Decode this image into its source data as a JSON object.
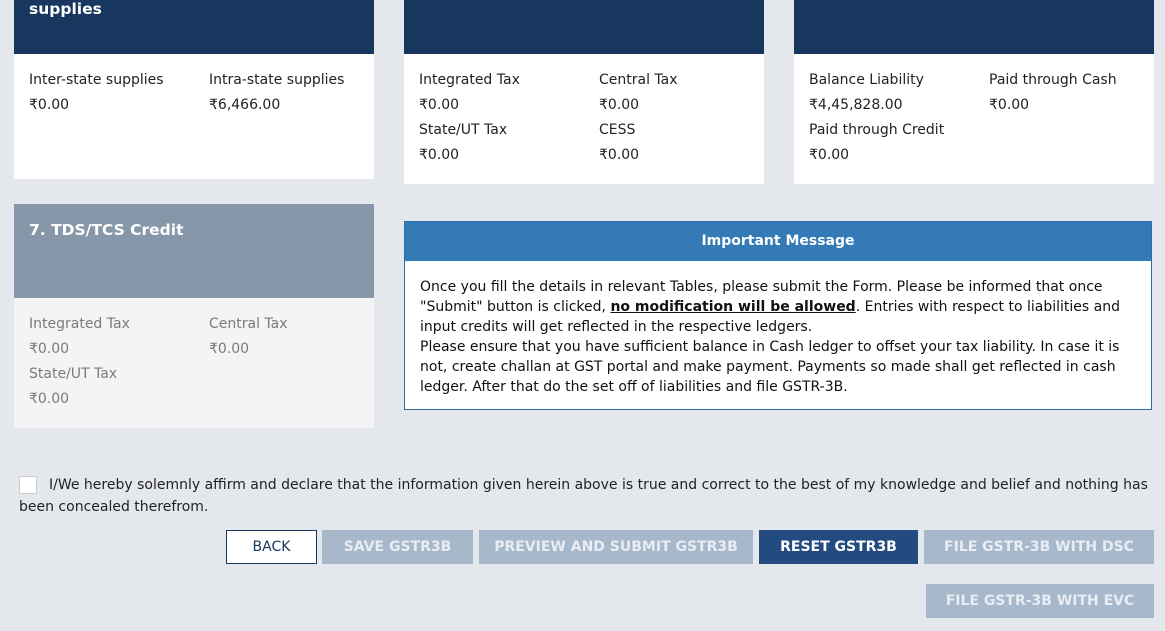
{
  "card1": {
    "title": "supplies",
    "fields": [
      {
        "label": "Inter-state supplies",
        "value": "₹0.00"
      },
      {
        "label": "Intra-state supplies",
        "value": "₹6,466.00"
      }
    ]
  },
  "card2": {
    "fields": [
      {
        "label": "Integrated Tax",
        "value": "₹0.00"
      },
      {
        "label": "Central Tax",
        "value": "₹0.00"
      },
      {
        "label": "State/UT Tax",
        "value": "₹0.00"
      },
      {
        "label": "CESS",
        "value": "₹0.00"
      }
    ]
  },
  "card3": {
    "fields": [
      {
        "label": "Balance Liability",
        "value": "₹4,45,828.00"
      },
      {
        "label": "Paid through Cash",
        "value": "₹0.00"
      },
      {
        "label": "Paid through Credit",
        "value": "₹0.00"
      }
    ]
  },
  "card4": {
    "title": "7. TDS/TCS Credit",
    "fields": [
      {
        "label": "Integrated Tax",
        "value": "₹0.00"
      },
      {
        "label": "Central Tax",
        "value": "₹0.00"
      },
      {
        "label": "State/UT Tax",
        "value": "₹0.00"
      }
    ]
  },
  "message": {
    "title": "Important Message",
    "p1_before": "Once you fill the details in relevant Tables, please submit the Form. Please be informed that once \"Submit\" button is clicked, ",
    "p1_bold": "no modification will be allowed",
    "p1_after": ". Entries with respect to liabilities and input credits will get reflected in the respective ledgers.",
    "p2": "Please ensure that you have sufficient balance in Cash ledger to offset your tax liability. In case it is not, create challan at GST portal and make payment. Payments so made shall get reflected in cash ledger. After that do the set off of liabilities and file GSTR-3B."
  },
  "declaration": {
    "checked": false,
    "text": "I/We hereby solemnly affirm and declare that the information given herein above is true and correct to the best of my knowledge and belief and nothing has been concealed therefrom."
  },
  "buttons": {
    "back": "BACK",
    "save": "SAVE GSTR3B",
    "preview": "PREVIEW AND SUBMIT GSTR3B",
    "reset": "RESET GSTR3B",
    "file_dsc": "FILE GSTR-3B WITH DSC",
    "file_evc": "FILE GSTR-3B WITH EVC"
  },
  "colors": {
    "header_dark": "#17375e",
    "header_grey": "#8597a8",
    "message_header": "#337ab7",
    "button_primary": "#234b80",
    "button_disabled": "#a8b8cb"
  }
}
